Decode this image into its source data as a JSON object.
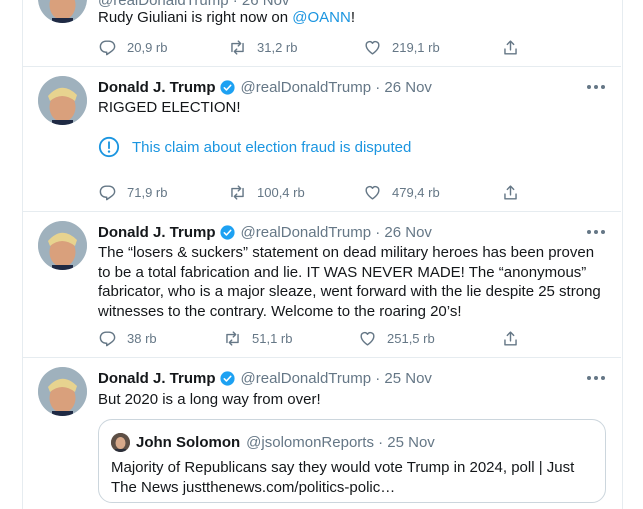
{
  "tweets": [
    {
      "name": "",
      "handle": "@realDonaldTrump · 26 Nov",
      "text_before": "Rudy Giuliani is right now on ",
      "mention": "@OANN",
      "text_after": "!",
      "replies": "20,9 rb",
      "retweets": "31,2 rb",
      "likes": "219,1 rb"
    },
    {
      "name": "Donald J. Trump",
      "handle": "@realDonaldTrump · 26 Nov",
      "text": "RIGGED ELECTION!",
      "notice": "This claim about election fraud is disputed",
      "replies": "71,9 rb",
      "retweets": "100,4 rb",
      "likes": "479,4 rb"
    },
    {
      "name": "Donald J. Trump",
      "handle": "@realDonaldTrump · 26 Nov",
      "text": "The “losers & suckers” statement on dead military heroes has been proven to be a total fabrication and lie. IT WAS NEVER MADE! The “anonymous” fabricator, who is a major sleaze, went forward with the lie despite 25 strong witnesses to the contrary. Welcome to the roaring 20’s!",
      "replies": "38 rb",
      "retweets": "51,1 rb",
      "likes": "251,5 rb"
    },
    {
      "name": "Donald J. Trump",
      "handle": "@realDonaldTrump · 25 Nov",
      "text": "But 2020 is a long way from over!",
      "quote": {
        "name": "John Solomon",
        "handle": "@jsolomonReports · 25 Nov",
        "text": "Majority of Republicans say they would vote Trump in 2024, poll | Just The News justthenews.com/politics-polic…"
      }
    }
  ],
  "colors": {
    "accent": "#1b95e0",
    "muted": "#657786",
    "border": "#e6ecf0"
  },
  "icons": [
    "reply-icon",
    "retweet-icon",
    "like-icon",
    "share-icon",
    "verified-badge-icon",
    "more-icon",
    "info-icon"
  ]
}
